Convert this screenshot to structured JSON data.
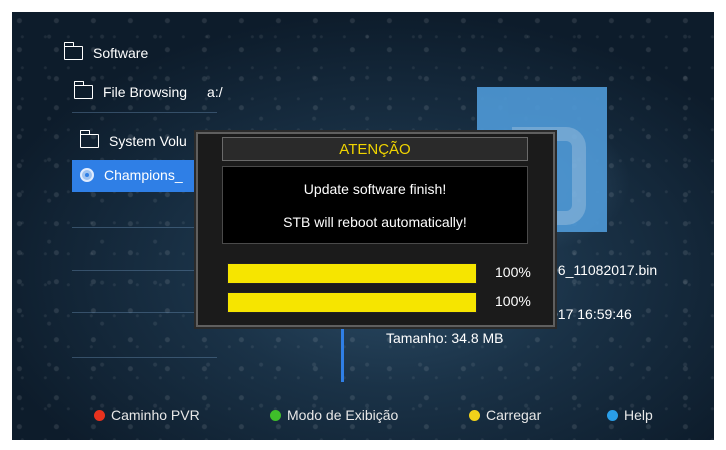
{
  "menu": {
    "software": "Software",
    "file_browsing": "File Browsing",
    "path": "a:/",
    "system_volume": "System Volu",
    "champions": "Champions_"
  },
  "file_info": {
    "filename_fragment": "06_11082017.bin",
    "date_fragment": "017 16:59:46",
    "size": "Tamanho: 34.8 MB"
  },
  "dialog": {
    "title": "ATENÇÃO",
    "line1": "Update software finish!",
    "line2": "STB will reboot automatically!",
    "progress": [
      {
        "label": "100%",
        "value": 100
      },
      {
        "label": "100%",
        "value": 100
      }
    ]
  },
  "footer": [
    {
      "label": "Caminho PVR",
      "color": "#e8321e"
    },
    {
      "label": "Modo de Exibição",
      "color": "#3fbf2a"
    },
    {
      "label": "Carregar",
      "color": "#f2d21a"
    },
    {
      "label": "Help",
      "color": "#2a9ee8"
    }
  ],
  "colors": {
    "accent": "#2f7fe6",
    "title_text": "#f0d400",
    "progress_fill": "#f6e500"
  }
}
